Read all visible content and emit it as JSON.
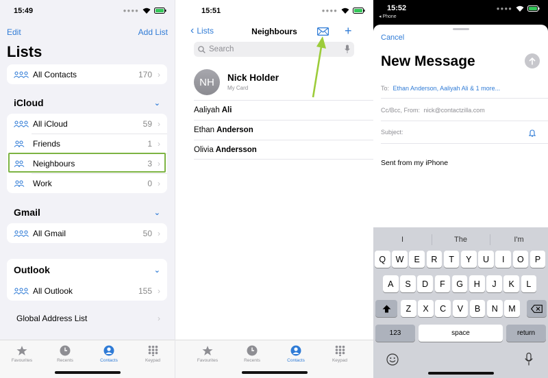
{
  "panel1": {
    "time": "15:49",
    "edit": "Edit",
    "add_list": "Add List",
    "title": "Lists",
    "all_contacts": {
      "label": "All Contacts",
      "count": "170"
    },
    "icloud": {
      "title": "iCloud",
      "items": [
        {
          "label": "All iCloud",
          "count": "59"
        },
        {
          "label": "Friends",
          "count": "1"
        },
        {
          "label": "Neighbours",
          "count": "3"
        },
        {
          "label": "Work",
          "count": "0"
        }
      ]
    },
    "gmail": {
      "title": "Gmail",
      "items": [
        {
          "label": "All Gmail",
          "count": "50"
        }
      ]
    },
    "outlook": {
      "title": "Outlook",
      "items": [
        {
          "label": "All Outlook",
          "count": "155"
        }
      ]
    },
    "global": "Global Address List",
    "tabs": [
      "Favourites",
      "Recents",
      "Contacts",
      "Keypad"
    ],
    "highlight_color": "#7cb342"
  },
  "panel2": {
    "time": "15:51",
    "back": "Lists",
    "title": "Neighbours",
    "search_placeholder": "Search",
    "me": {
      "initials": "NH",
      "name": "Nick Holder",
      "sub": "My Card"
    },
    "contacts": [
      {
        "first": "Aaliyah",
        "last": "Ali"
      },
      {
        "first": "Ethan",
        "last": "Anderson"
      },
      {
        "first": "Olivia",
        "last": "Andersson"
      }
    ],
    "tabs": [
      "Favourites",
      "Recents",
      "Contacts",
      "Keypad"
    ]
  },
  "panel3": {
    "time": "15:52",
    "back_app": "◂ Phone",
    "cancel": "Cancel",
    "title": "New Message",
    "to_label": "To:",
    "to_value": "Ethan Anderson, Aaliyah Ali & 1 more...",
    "ccbcc_label": "Cc/Bcc, From:",
    "from_value": "nick@contactzilla.com",
    "subject_label": "Subject:",
    "body": "Sent from my iPhone",
    "suggestions": [
      "I",
      "The",
      "I'm"
    ],
    "row1": [
      "Q",
      "W",
      "E",
      "R",
      "T",
      "Y",
      "U",
      "I",
      "O",
      "P"
    ],
    "row2": [
      "A",
      "S",
      "D",
      "F",
      "G",
      "H",
      "J",
      "K",
      "L"
    ],
    "row3": [
      "Z",
      "X",
      "C",
      "V",
      "B",
      "N",
      "M"
    ],
    "key_123": "123",
    "key_space": "space",
    "key_return": "return"
  },
  "colors": {
    "accent": "#2f7bd6",
    "arrow": "#9ccc3a"
  }
}
